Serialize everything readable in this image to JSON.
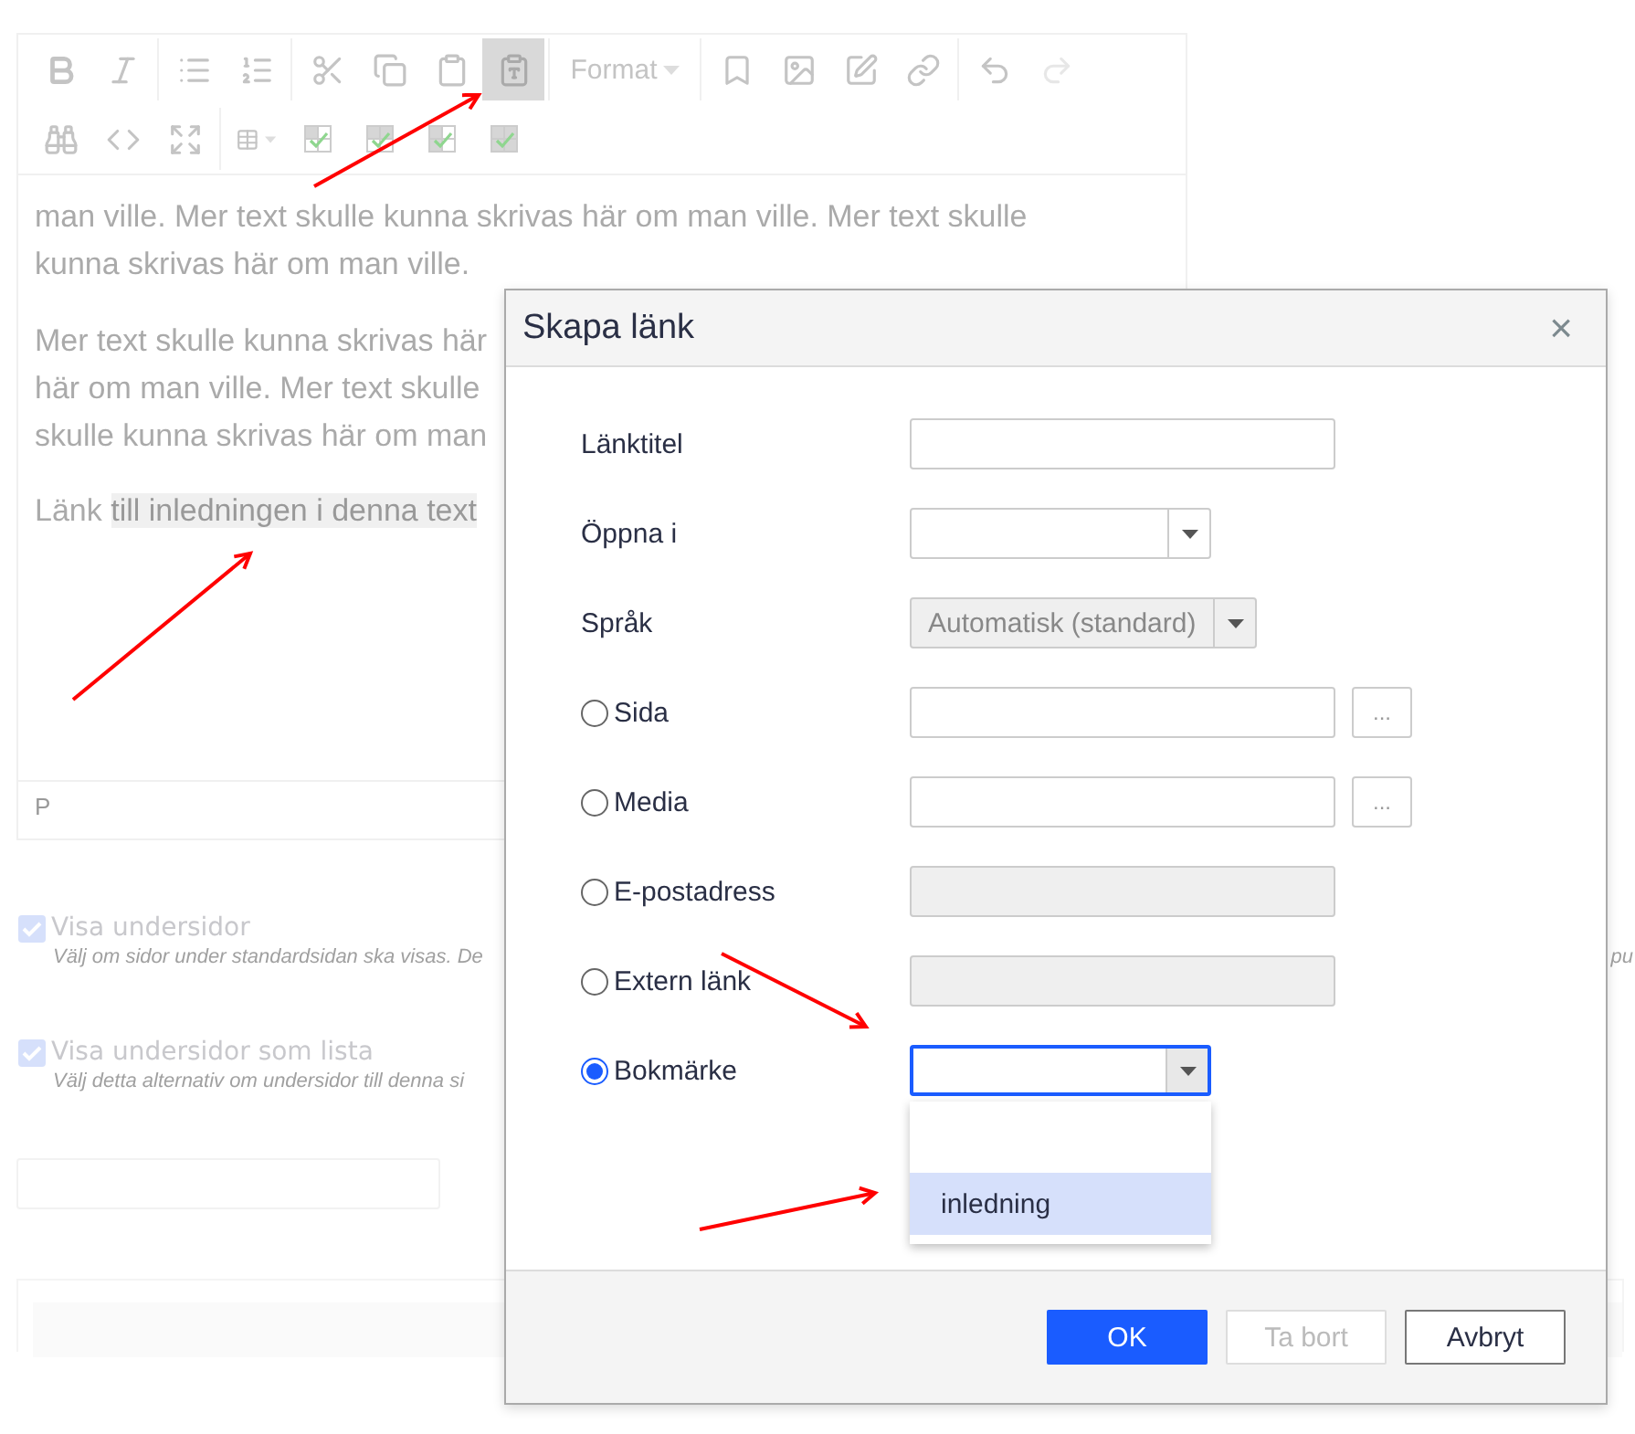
{
  "editor": {
    "toolbar": [
      [
        [
          {
            "kind": "bold",
            "active": false,
            "disabled": false
          },
          {
            "kind": "italic",
            "active": false,
            "disabled": false
          }
        ],
        [
          {
            "kind": "bullets",
            "active": false,
            "disabled": false
          },
          {
            "kind": "numbers",
            "active": false,
            "disabled": false
          }
        ],
        [
          {
            "kind": "cut",
            "active": false,
            "disabled": false
          },
          {
            "kind": "copy",
            "active": false,
            "disabled": false
          },
          {
            "kind": "paste",
            "active": false,
            "disabled": false
          },
          {
            "kind": "paste-text",
            "active": true,
            "disabled": false
          }
        ],
        [
          {
            "kind": "dropdown",
            "label": "Format",
            "active": false,
            "disabled": false
          }
        ],
        [
          {
            "kind": "bookmark",
            "active": false,
            "disabled": false
          },
          {
            "kind": "image",
            "active": false,
            "disabled": false
          },
          {
            "kind": "edit",
            "active": false,
            "disabled": false
          },
          {
            "kind": "link",
            "active": false,
            "disabled": false
          }
        ],
        [
          {
            "kind": "undo",
            "active": false,
            "disabled": false
          },
          {
            "kind": "redo",
            "active": false,
            "disabled": true
          }
        ]
      ],
      [
        [
          {
            "kind": "find",
            "active": false,
            "disabled": false
          },
          {
            "kind": "code",
            "active": false,
            "disabled": false
          },
          {
            "kind": "fullscreen",
            "active": false,
            "disabled": false
          }
        ],
        [
          {
            "kind": "table",
            "active": false,
            "disabled": false
          },
          {
            "kind": "cell-props",
            "active": false,
            "disabled": false
          },
          {
            "kind": "row-props",
            "active": false,
            "disabled": false
          },
          {
            "kind": "col-props",
            "active": false,
            "disabled": false
          },
          {
            "kind": "table-props",
            "active": false,
            "disabled": false
          }
        ]
      ]
    ],
    "paragraph": "man ville. Mer text skulle kunna skrivas här om man ville. Mer text skulle kunna skrivas här om man ville.",
    "covered_lines": [
      "Mer text skulle kunna skrivas här",
      "här om man ville. Mer text skulle",
      "skulle kunna skrivas här om man"
    ],
    "link_line": {
      "text": "Länk",
      "highlighted": "till inledningen i denna text"
    },
    "status": "P"
  },
  "options": [
    {
      "label": "Visa undersidor",
      "checked": true,
      "description": "Välj om sidor under standardsidan ska visas. De",
      "description_tail": "pu"
    },
    {
      "label": "Visa undersidor som lista",
      "checked": true,
      "description": "Välj detta alternativ om undersidor till denna si"
    }
  ],
  "dialog": {
    "title": "Skapa länk",
    "close": "×",
    "rows": [
      {
        "kind": "text",
        "label": "Länktitel"
      },
      {
        "kind": "select",
        "label": "Öppna i",
        "disabled": false,
        "focused": false
      },
      {
        "kind": "select",
        "label": "Språk",
        "value": "Automatisk (standard)",
        "disabled": true,
        "focused": false
      },
      {
        "kind": "radio-browse",
        "label": "Sida",
        "selected": false,
        "browse": "..."
      },
      {
        "kind": "radio-browse",
        "label": "Media",
        "selected": false,
        "browse": "..."
      },
      {
        "kind": "radio-text",
        "label": "E-postadress",
        "selected": false,
        "disabled": true
      },
      {
        "kind": "radio-text",
        "label": "Extern länk",
        "selected": false,
        "disabled": true
      },
      {
        "kind": "radio-select",
        "label": "Bokmärke",
        "selected": true,
        "focused": true,
        "expanded": true,
        "options": [
          {
            "label": "inledning",
            "highlighted": true
          }
        ]
      }
    ],
    "buttons": [
      {
        "label": "OK",
        "kind": "primary",
        "disabled": false
      },
      {
        "label": "Ta bort",
        "kind": "secondary",
        "disabled": true
      },
      {
        "label": "Avbryt",
        "kind": "secondary",
        "disabled": false
      }
    ]
  }
}
